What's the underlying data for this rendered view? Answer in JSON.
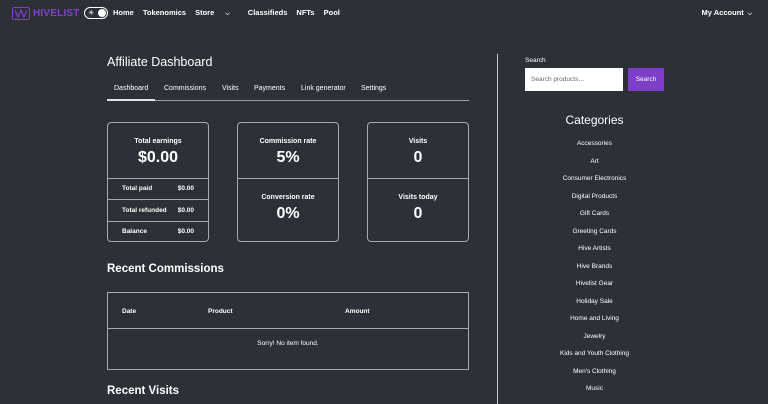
{
  "brand": {
    "name": "HIVELIST",
    "color": "#7f3fd1"
  },
  "theme_toggle": {
    "icon": "sun-icon",
    "state": "dark"
  },
  "nav": {
    "links": [
      {
        "label": "Home"
      },
      {
        "label": "Tokenomics"
      },
      {
        "label": "Store",
        "dropdown": true
      },
      {
        "label": "Classifieds"
      },
      {
        "label": "NFTs"
      },
      {
        "label": "Pool"
      }
    ],
    "account": "My Account"
  },
  "main": {
    "title": "Affiliate Dashboard",
    "tabs": [
      "Dashboard",
      "Commissions",
      "Visits",
      "Payments",
      "Link generator",
      "Settings"
    ],
    "active_tab": "Dashboard",
    "earnings": {
      "label": "Total earnings",
      "value": "$0.00",
      "rows": [
        {
          "label": "Total paid",
          "value": "$0.00"
        },
        {
          "label": "Total refunded",
          "value": "$0.00"
        },
        {
          "label": "Balance",
          "value": "$0.00"
        }
      ]
    },
    "commission": {
      "rate_label": "Commission rate",
      "rate_value": "5%",
      "conv_label": "Conversion rate",
      "conv_value": "0%"
    },
    "visits": {
      "label": "Visits",
      "value": "0",
      "today_label": "Visits today",
      "today_value": "0"
    },
    "recent_commissions": {
      "title": "Recent Commissions",
      "columns": [
        "Date",
        "Product",
        "Amount"
      ],
      "empty": "Sorry! No item found."
    },
    "recent_visits": {
      "title": "Recent Visits"
    }
  },
  "sidebar": {
    "search": {
      "label": "Search",
      "placeholder": "Search products…",
      "button": "Search",
      "button_color": "#7b3fc8"
    },
    "categories_title": "Categories",
    "categories": [
      "Accessories",
      "Art",
      "Consumer Electronics",
      "Digital Products",
      "Gift Cards",
      "Greeting Cards",
      "Hive Artists",
      "Hive Brands",
      "Hivelist Gear",
      "Holiday Sale",
      "Home and Living",
      "Jewelry",
      "Kids and Youth Clothing",
      "Men's Clothing",
      "Music"
    ]
  }
}
